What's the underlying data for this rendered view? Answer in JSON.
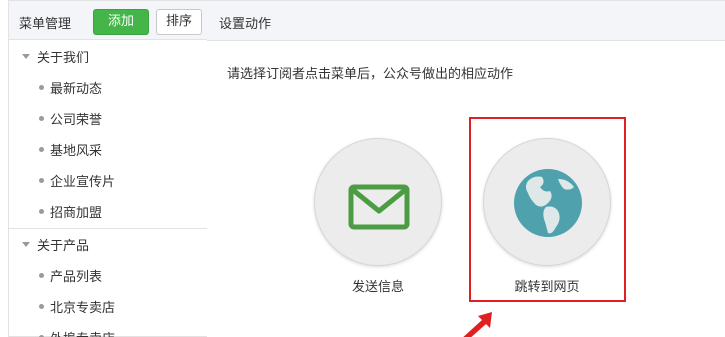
{
  "left": {
    "title": "菜单管理",
    "add_label": "添加",
    "sort_label": "排序",
    "groups": [
      {
        "label": "关于我们",
        "children": [
          "最新动态",
          "公司荣誉",
          "基地风采",
          "企业宣传片",
          "招商加盟"
        ]
      },
      {
        "label": "关于产品",
        "children": [
          "产品列表",
          "北京专卖店",
          "外埠专卖店"
        ]
      }
    ]
  },
  "right": {
    "title": "设置动作",
    "description": "请选择订阅者点击菜单后，公众号做出的相应动作",
    "actions": [
      {
        "label": "发送信息",
        "icon": "envelope-icon"
      },
      {
        "label": "跳转到网页",
        "icon": "globe-icon"
      }
    ]
  },
  "colors": {
    "accent_green": "#44b549",
    "highlight_red": "#e02020",
    "globe_blue": "#4fa2ad"
  }
}
